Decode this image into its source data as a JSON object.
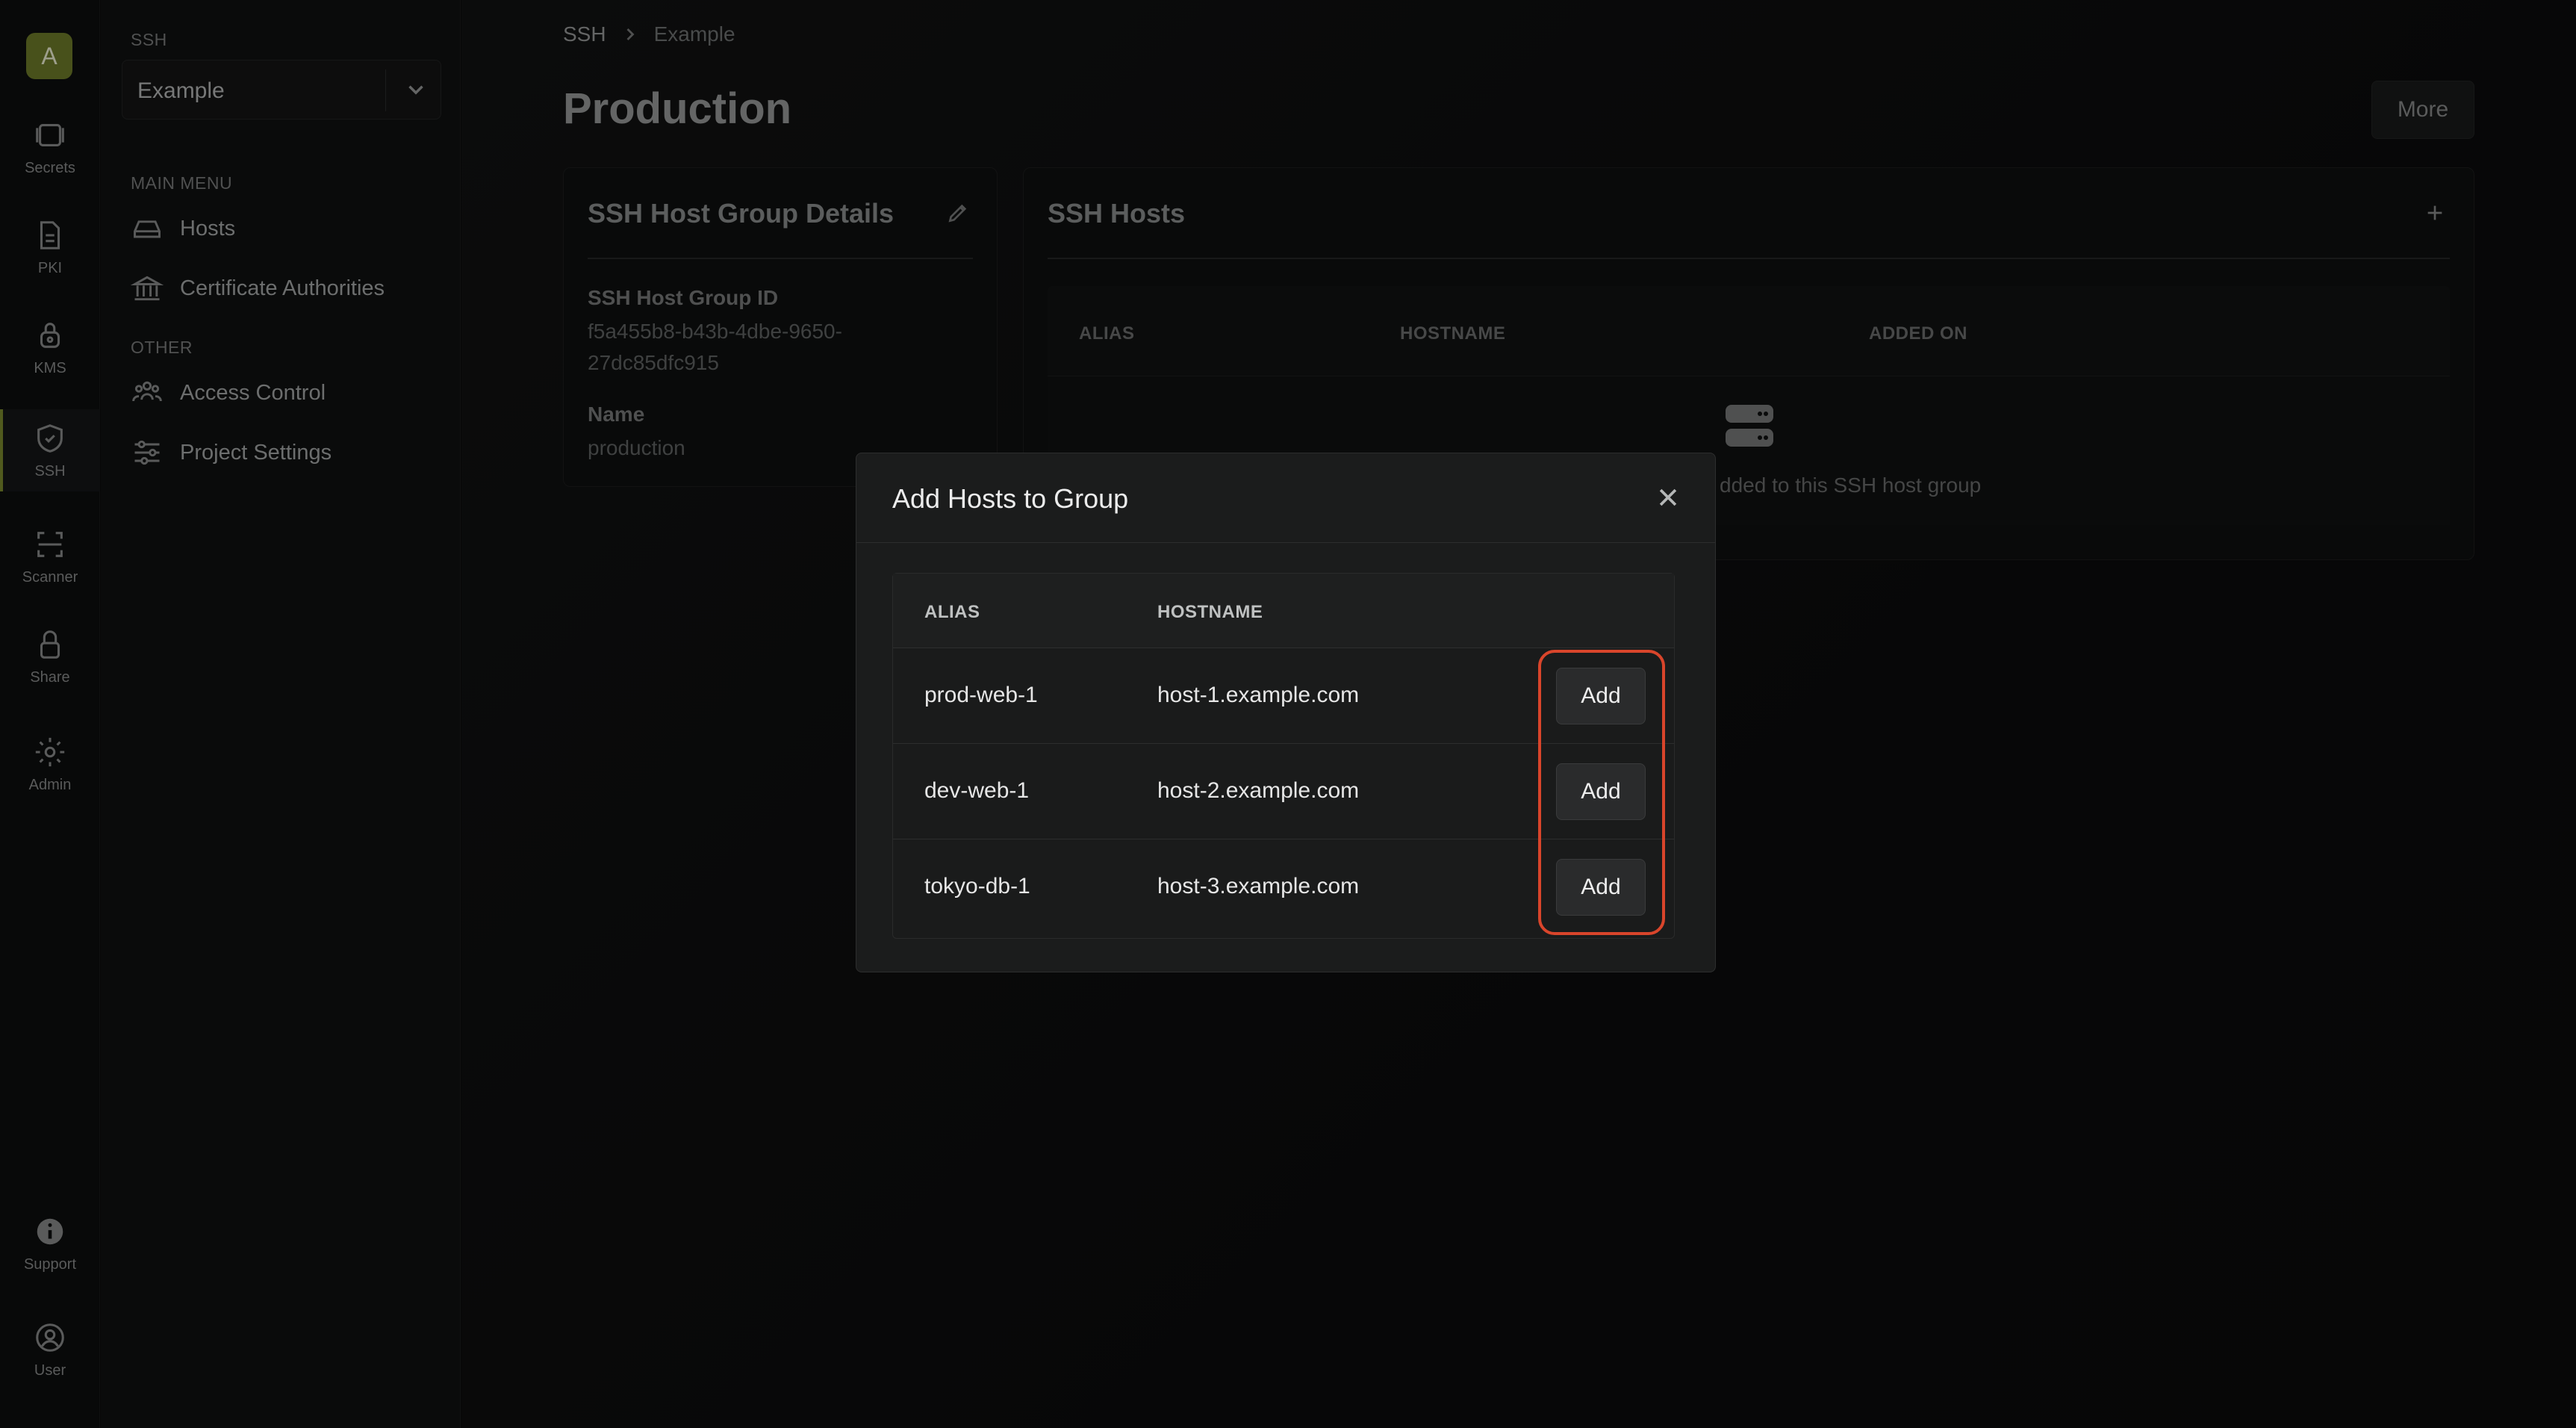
{
  "org_initial": "A",
  "rail": [
    {
      "label": "Secrets",
      "icon": "secrets-icon"
    },
    {
      "label": "PKI",
      "icon": "pki-icon"
    },
    {
      "label": "KMS",
      "icon": "kms-icon"
    },
    {
      "label": "SSH",
      "icon": "ssh-icon"
    },
    {
      "label": "Scanner",
      "icon": "scanner-icon"
    },
    {
      "label": "Share",
      "icon": "share-icon"
    },
    {
      "label": "Admin",
      "icon": "admin-icon"
    },
    {
      "label": "Support",
      "icon": "support-icon"
    },
    {
      "label": "User",
      "icon": "user-icon"
    }
  ],
  "sidebar": {
    "section_title": "SSH",
    "project": "Example",
    "main_menu_label": "MAIN MENU",
    "main_menu": [
      "Hosts",
      "Certificate Authorities"
    ],
    "other_label": "OTHER",
    "other": [
      "Access Control",
      "Project Settings"
    ]
  },
  "breadcrumb": {
    "root": "SSH",
    "current": "Example"
  },
  "page": {
    "title": "Production",
    "more_label": "More"
  },
  "details": {
    "title": "SSH Host Group Details",
    "id_label": "SSH Host Group ID",
    "id_value": "f5a455b8-b43b-4dbe-9650-27dc85dfc915",
    "name_label": "Name",
    "name_value": "production"
  },
  "hosts_card": {
    "title": "SSH Hosts",
    "columns": [
      "ALIAS",
      "HOSTNAME",
      "ADDED ON"
    ],
    "empty_text": "dded to this SSH host group"
  },
  "modal": {
    "title": "Add Hosts to Group",
    "columns": [
      "ALIAS",
      "HOSTNAME"
    ],
    "rows": [
      {
        "alias": "prod-web-1",
        "hostname": "host-1.example.com",
        "action": "Add"
      },
      {
        "alias": "dev-web-1",
        "hostname": "host-2.example.com",
        "action": "Add"
      },
      {
        "alias": "tokyo-db-1",
        "hostname": "host-3.example.com",
        "action": "Add"
      }
    ]
  },
  "colors": {
    "accent": "#7c8a2e",
    "highlight": "#d9452b"
  }
}
